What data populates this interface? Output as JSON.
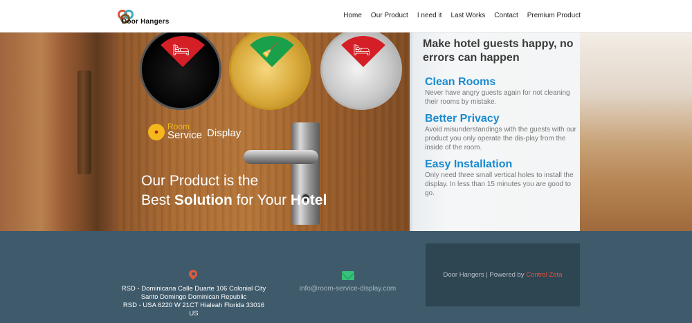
{
  "header": {
    "logo_text": "Door Hangers",
    "nav": [
      "Home",
      "Our Product",
      "I need it",
      "Last Works",
      "Contact",
      "Premium Product"
    ]
  },
  "hero": {
    "brand": {
      "line1": "Room",
      "line2": "Service",
      "line3": "Display"
    },
    "slogan": {
      "line1": "Our Product is the",
      "line2_prefix": "Best ",
      "line2_bold1": "Solution",
      "line2_mid": " for Your ",
      "line2_bold2": "Hotel"
    }
  },
  "panel": {
    "title": "Make hotel guests happy, no errors can happen",
    "features": [
      {
        "title": "Clean Rooms",
        "text": "Never have angry guests again for not cleaning their rooms by mistake."
      },
      {
        "title": "Better Privacy",
        "text": "Avoid misunderstandings with the guests with our product you only operate the dis-play from the inside of the room."
      },
      {
        "title": "Easy Installation",
        "text": "Only need three small vertical holes to install the display. In less than 15 minutes you are good to go."
      }
    ]
  },
  "footer": {
    "address": [
      "RSD - Dominicana Calle Duarte 106 Colonial City",
      "Santo Domingo Dominican Republic",
      "RSD - USA 6220 W 21CT Hialeah Florida 33016",
      "US"
    ],
    "email": "info@room-service-display.com",
    "credit_prefix": "Door Hangers | Powered by ",
    "credit_brand": "Control Zeta"
  },
  "colors": {
    "accent_blue": "#1a8bd0",
    "footer_bg": "#3e5a6b",
    "pin": "#e05a3c",
    "mail": "#35c27a",
    "brand_red": "#e8543a"
  },
  "icons": [
    "logo-icon",
    "do-not-disturb-icon",
    "make-up-room-icon",
    "location-pin-icon",
    "envelope-icon"
  ]
}
